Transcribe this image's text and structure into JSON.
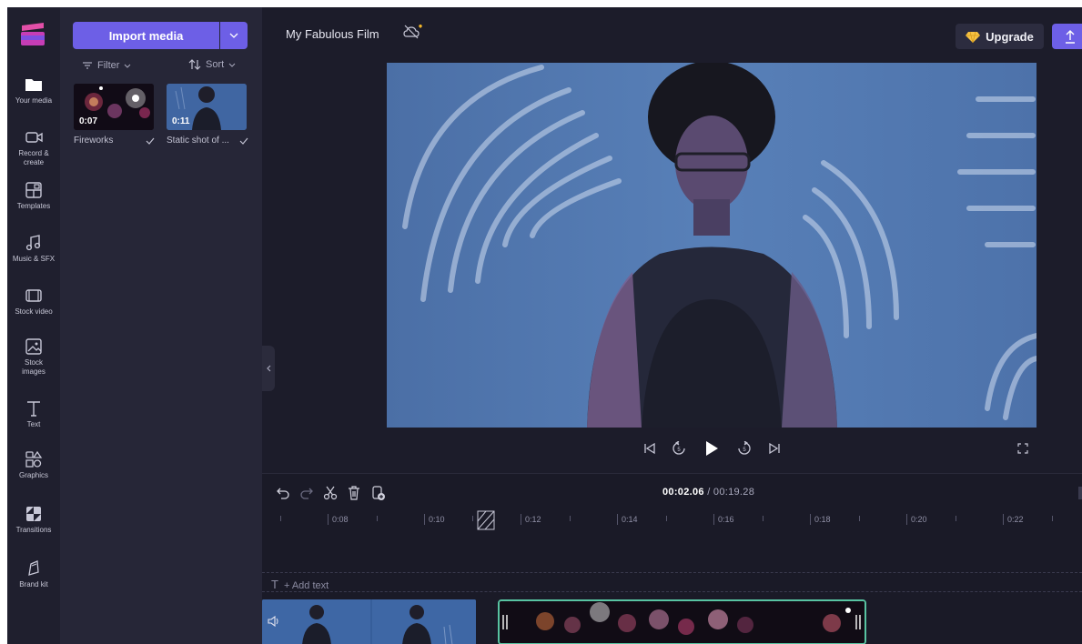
{
  "app": {
    "project_title": "My Fabulous Film",
    "colors": {
      "accent": "#6d5fe6",
      "bg": "#1c1c2a",
      "panel": "#262637",
      "selection": "#58c4a2"
    }
  },
  "nav": [
    {
      "label": "Your media",
      "icon": "folder-icon"
    },
    {
      "label": "Record &\ncreate",
      "icon": "camera-icon"
    },
    {
      "label": "Templates",
      "icon": "templates-icon"
    },
    {
      "label": "Music & SFX",
      "icon": "music-icon"
    },
    {
      "label": "Stock video",
      "icon": "film-icon"
    },
    {
      "label": "Stock\nimages",
      "icon": "image-icon"
    },
    {
      "label": "Text",
      "icon": "text-icon"
    },
    {
      "label": "Graphics",
      "icon": "shapes-icon"
    },
    {
      "label": "Transitions",
      "icon": "transitions-icon"
    },
    {
      "label": "Brand kit",
      "icon": "brand-kit-icon"
    }
  ],
  "media": {
    "import_label": "Import media",
    "filter_label": "Filter",
    "sort_label": "Sort",
    "items": [
      {
        "name": "Fireworks",
        "duration": "0:07"
      },
      {
        "name": "Static shot of ...",
        "duration": "0:11"
      }
    ]
  },
  "header": {
    "upgrade_label": "Upgrade"
  },
  "timeline": {
    "current_time": "00:02.06",
    "total_time": "/ 00:19.28",
    "ticks": [
      "0:08",
      "0:10",
      "0:12",
      "0:14",
      "0:16",
      "0:18",
      "0:20",
      "0:22"
    ],
    "add_text_label": "+ Add text"
  }
}
